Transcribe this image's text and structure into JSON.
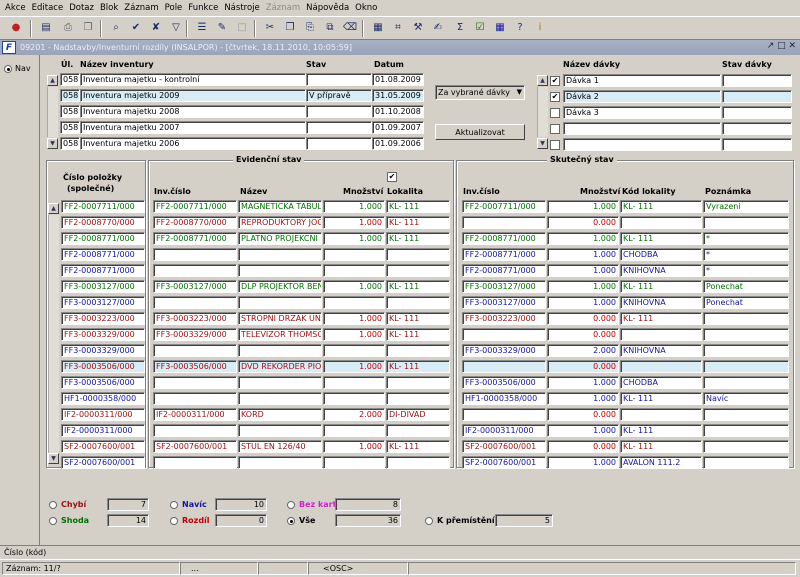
{
  "menu": [
    "Akce",
    "Editace",
    "Dotaz",
    "Blok",
    "Záznam",
    "Pole",
    "Funkce",
    "Nástroje",
    "Záznam",
    "Nápověda",
    "Okno"
  ],
  "window": {
    "title": "09201 - Nadstavby/Inventurní rozdíly (INSALPOR) - [čtvrtek, 18.11.2010, 10:05:59]",
    "controls": "↗ □ ✕"
  },
  "nav_label": "Nav",
  "inventury": {
    "headers": {
      "ul": "Úl.",
      "nazev": "Název inventury",
      "stav": "Stav",
      "datum": "Datum"
    },
    "rows": [
      {
        "ul": "058",
        "nazev": "Inventura majetku - kontrolní",
        "stav": "",
        "datum": "01.08.2009"
      },
      {
        "ul": "058",
        "nazev": "Inventura majetku 2009",
        "stav": "V přípravě",
        "datum": "31.05.2009"
      },
      {
        "ul": "058",
        "nazev": "Inventura majetku 2008",
        "stav": "",
        "datum": "01.10.2008"
      },
      {
        "ul": "058",
        "nazev": "Inventura majetku 2007",
        "stav": "",
        "datum": "01.09.2007"
      },
      {
        "ul": "058",
        "nazev": "Inventura majetku 2006",
        "stav": "",
        "datum": "01.09.2006"
      }
    ]
  },
  "filter": {
    "select_value": "Za vybrané dávky",
    "refresh_button": "Aktualizovat"
  },
  "davky": {
    "headers": {
      "nazev": "Název dávky",
      "stav": "Stav dávky"
    },
    "rows": [
      {
        "checked": true,
        "nazev": "Dávka 1",
        "stav": ""
      },
      {
        "checked": true,
        "nazev": "Dávka 2",
        "stav": ""
      },
      {
        "checked": false,
        "nazev": "Dávka 3",
        "stav": ""
      },
      {
        "checked": false,
        "nazev": "",
        "stav": ""
      },
      {
        "checked": false,
        "nazev": "",
        "stav": ""
      }
    ]
  },
  "polozky": {
    "header_line1": "Číslo položky",
    "header_line2": "(společné)"
  },
  "evidencni": {
    "title": "Evidenční stav",
    "checkbox_checked": true,
    "headers": {
      "inv": "Inv.číslo",
      "nazev": "Název",
      "mnozstvi": "Množství",
      "lokalita": "Lokalita"
    }
  },
  "skutecny": {
    "title": "Skutečný stav",
    "headers": {
      "inv": "Inv.číslo",
      "mnozstvi": "Množství",
      "kod": "Kód lokality",
      "poznamka": "Poznámka"
    }
  },
  "rows": [
    {
      "cislo": "FF2-0007711/000",
      "c": "g",
      "e_inv": "FF2-0007711/000",
      "e_nazev": "MAGNETICKA TABULE",
      "e_mn": "1.000",
      "e_lok": "KL- 111",
      "s_inv": "FF2-0007711/000",
      "s_mn": "1.000",
      "s_kod": "KL- 111",
      "s_pozn": "Vyrazeni"
    },
    {
      "cislo": "FF2-0008770/000",
      "c": "r",
      "e_inv": "FF2-0008770/000",
      "e_nazev": "REPRODUKTORY JOGY",
      "e_mn": "1.000",
      "e_lok": "KL- 111",
      "s_inv": "",
      "s_mn": "0.000",
      "s_kod": "",
      "s_pozn": ""
    },
    {
      "cislo": "FF2-0008771/000",
      "c": "g",
      "e_inv": "FF2-0008771/000",
      "e_nazev": "PLATNO PROJEKCNI",
      "e_mn": "1.000",
      "e_lok": "KL- 111",
      "s_inv": "FF2-0008771/000",
      "s_mn": "1.000",
      "s_kod": "KL- 111",
      "s_pozn": "*"
    },
    {
      "cislo": "FF2-0008771/000",
      "c": "b",
      "e_inv": "",
      "e_nazev": "",
      "e_mn": "",
      "e_lok": "",
      "s_inv": "FF2-0008771/000",
      "s_mn": "1.000",
      "s_kod": "CHODBA",
      "s_pozn": "*"
    },
    {
      "cislo": "FF2-0008771/000",
      "c": "b",
      "e_inv": "",
      "e_nazev": "",
      "e_mn": "",
      "e_lok": "",
      "s_inv": "FF2-0008771/000",
      "s_mn": "1.000",
      "s_kod": "KNIHOVNA",
      "s_pozn": "*"
    },
    {
      "cislo": "FF3-0003127/000",
      "c": "g",
      "e_inv": "FF3-0003127/000",
      "e_nazev": "DLP PROJEKTOR BENQ",
      "e_mn": "1.000",
      "e_lok": "KL- 111",
      "s_inv": "FF3-0003127/000",
      "s_mn": "1.000",
      "s_kod": "KL- 111",
      "s_pozn": "Ponechat"
    },
    {
      "cislo": "FF3-0003127/000",
      "c": "b",
      "e_inv": "",
      "e_nazev": "",
      "e_mn": "",
      "e_lok": "",
      "s_inv": "FF3-0003127/000",
      "s_mn": "1.000",
      "s_kod": "KNIHOVNA",
      "s_pozn": "Ponechat"
    },
    {
      "cislo": "FF3-0003223/000",
      "c": "r",
      "e_inv": "FF3-0003223/000",
      "e_nazev": "STROPNI DRZAK UNI",
      "e_mn": "1.000",
      "e_lok": "KL- 111",
      "s_inv": "FF3-0003223/000",
      "s_mn": "0.000",
      "s_kod": "KL- 111",
      "s_pozn": ""
    },
    {
      "cislo": "FF3-0003329/000",
      "c": "r",
      "e_inv": "FF3-0003329/000",
      "e_nazev": "TELEVIZOR THOMSON",
      "e_mn": "1.000",
      "e_lok": "KL- 111",
      "s_inv": "",
      "s_mn": "0.000",
      "s_kod": "",
      "s_pozn": ""
    },
    {
      "cislo": "FF3-0003329/000",
      "c": "b",
      "e_inv": "",
      "e_nazev": "",
      "e_mn": "",
      "e_lok": "",
      "s_inv": "FF3-0003329/000",
      "s_mn": "2.000",
      "s_kod": "KNIHOVNA",
      "s_pozn": ""
    },
    {
      "cislo": "FF3-0003506/000",
      "c": "r",
      "e_inv": "FF3-0003506/000",
      "e_nazev": "DVD REKORDER PIONEER",
      "e_mn": "1.000",
      "e_lok": "KL- 111",
      "s_inv": "",
      "s_mn": "0.000",
      "s_kod": "",
      "s_pozn": "",
      "sel": true
    },
    {
      "cislo": "FF3-0003506/000",
      "c": "b",
      "e_inv": "",
      "e_nazev": "",
      "e_mn": "",
      "e_lok": "",
      "s_inv": "FF3-0003506/000",
      "s_mn": "1.000",
      "s_kod": "CHODBA",
      "s_pozn": ""
    },
    {
      "cislo": "HF1-0000358/000",
      "c": "b",
      "e_inv": "",
      "e_nazev": "",
      "e_mn": "",
      "e_lok": "",
      "s_inv": "HF1-0000358/000",
      "s_mn": "1.000",
      "s_kod": "KL- 111",
      "s_pozn": "Navíc"
    },
    {
      "cislo": "IF2-0000311/000",
      "c": "r",
      "e_inv": "IF2-0000311/000",
      "e_nazev": "KORD",
      "e_mn": "2.000",
      "e_lok": "DI-DIVAD",
      "s_inv": "",
      "s_mn": "0.000",
      "s_kod": "",
      "s_pozn": ""
    },
    {
      "cislo": "IF2-0000311/000",
      "c": "b",
      "e_inv": "",
      "e_nazev": "",
      "e_mn": "",
      "e_lok": "",
      "s_inv": "IF2-0000311/000",
      "s_mn": "1.000",
      "s_kod": "KL- 111",
      "s_pozn": ""
    },
    {
      "cislo": "SF2-0007600/001",
      "c": "r",
      "e_inv": "SF2-0007600/001",
      "e_nazev": "STUL EN 126/40",
      "e_mn": "1.000",
      "e_lok": "KL- 111",
      "s_inv": "SF2-0007600/001",
      "s_mn": "0.000",
      "s_kod": "KL- 111",
      "s_pozn": ""
    },
    {
      "cislo": "SF2-0007600/001",
      "c": "b",
      "e_inv": "",
      "e_nazev": "",
      "e_mn": "",
      "e_lok": "",
      "s_inv": "SF2-0007600/001",
      "s_mn": "1.000",
      "s_kod": "AVALON 111.2",
      "s_pozn": ""
    }
  ],
  "summary": [
    {
      "label": "Chybí",
      "count": "7",
      "color": "#9a1010",
      "selected": false
    },
    {
      "label": "Navíc",
      "count": "10",
      "color": "#1414a0",
      "selected": false
    },
    {
      "label": "Bez karty",
      "count": "8",
      "color": "#d020d0",
      "selected": false
    },
    {
      "label": "Shoda",
      "count": "14",
      "color": "#007000",
      "selected": false
    },
    {
      "label": "Rozdíl",
      "count": "0",
      "color": "#c00000",
      "selected": false
    },
    {
      "label": "Vše",
      "count": "36",
      "color": "#000000",
      "selected": true
    },
    {
      "label": "K přemístění",
      "count": "5",
      "color": "#000000",
      "selected": false
    }
  ],
  "status": {
    "field": "Číslo (kód)",
    "record": "Záznam: 11/?",
    "mid": "...",
    "mode": "<OSC>"
  }
}
